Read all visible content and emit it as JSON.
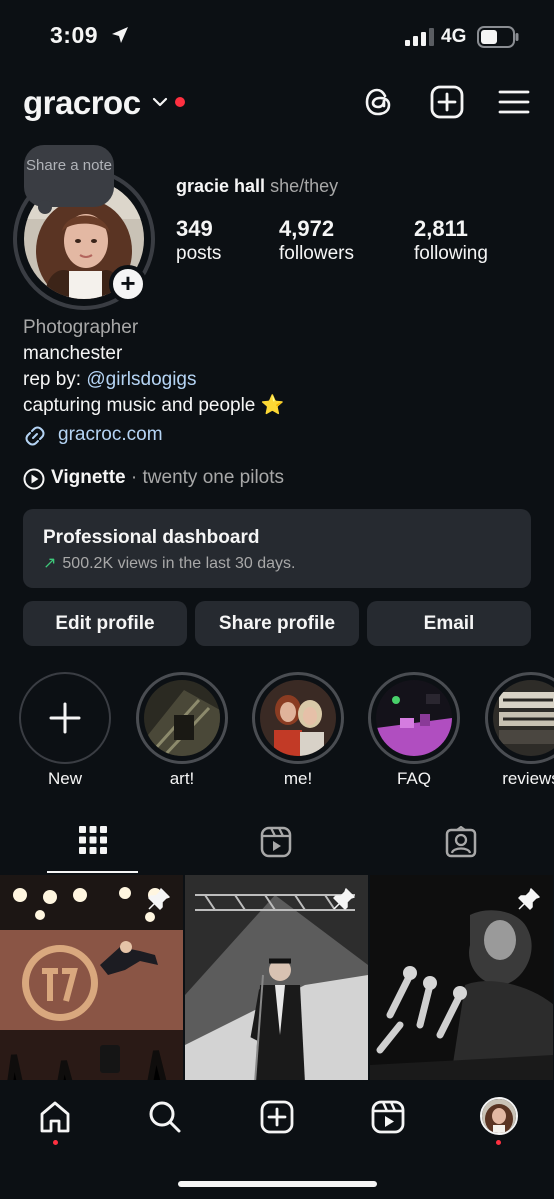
{
  "status_bar": {
    "time": "3:09",
    "network": "4G",
    "location_icon": "location-arrow-icon",
    "signal_icon": "cellular-signal-icon",
    "battery_icon": "battery-icon"
  },
  "header": {
    "username": "gracroc",
    "notification_color": "#ff3040",
    "icons": [
      "threads-icon",
      "create-post-icon",
      "menu-icon"
    ]
  },
  "profile": {
    "note_prompt": "Share a note",
    "full_name": "gracie hall",
    "pronouns": "she/they",
    "stats": [
      {
        "value": "349",
        "label": "posts"
      },
      {
        "value": "4,972",
        "label": "followers"
      },
      {
        "value": "2,811",
        "label": "following"
      }
    ],
    "category": "Photographer",
    "bio_lines": [
      "manchester",
      "rep by: ",
      "capturing music and people ⭐"
    ],
    "bio_mention": "@girlsdogigs",
    "link": "gracroc.com",
    "music": {
      "song": "Vignette",
      "separator": " · ",
      "artist": "twenty one pilots"
    }
  },
  "dashboard": {
    "title": "Professional dashboard",
    "subtitle": "500.2K views in the last 30 days.",
    "trend_color": "#3ec97b"
  },
  "actions": {
    "edit": "Edit profile",
    "share": "Share profile",
    "email": "Email"
  },
  "highlights": [
    {
      "label": "New"
    },
    {
      "label": "art!"
    },
    {
      "label": "me!"
    },
    {
      "label": "FAQ"
    },
    {
      "label": "reviews"
    }
  ],
  "tabs": [
    "grid-icon",
    "reels-icon",
    "tagged-icon"
  ],
  "bottom_nav": [
    "home-icon",
    "search-icon",
    "create-icon",
    "reels-icon",
    "profile-avatar"
  ],
  "colors": {
    "background": "#0c1014",
    "surface": "#262a30",
    "link": "#b5d4f4",
    "secondary_text": "#a8a8a8"
  }
}
